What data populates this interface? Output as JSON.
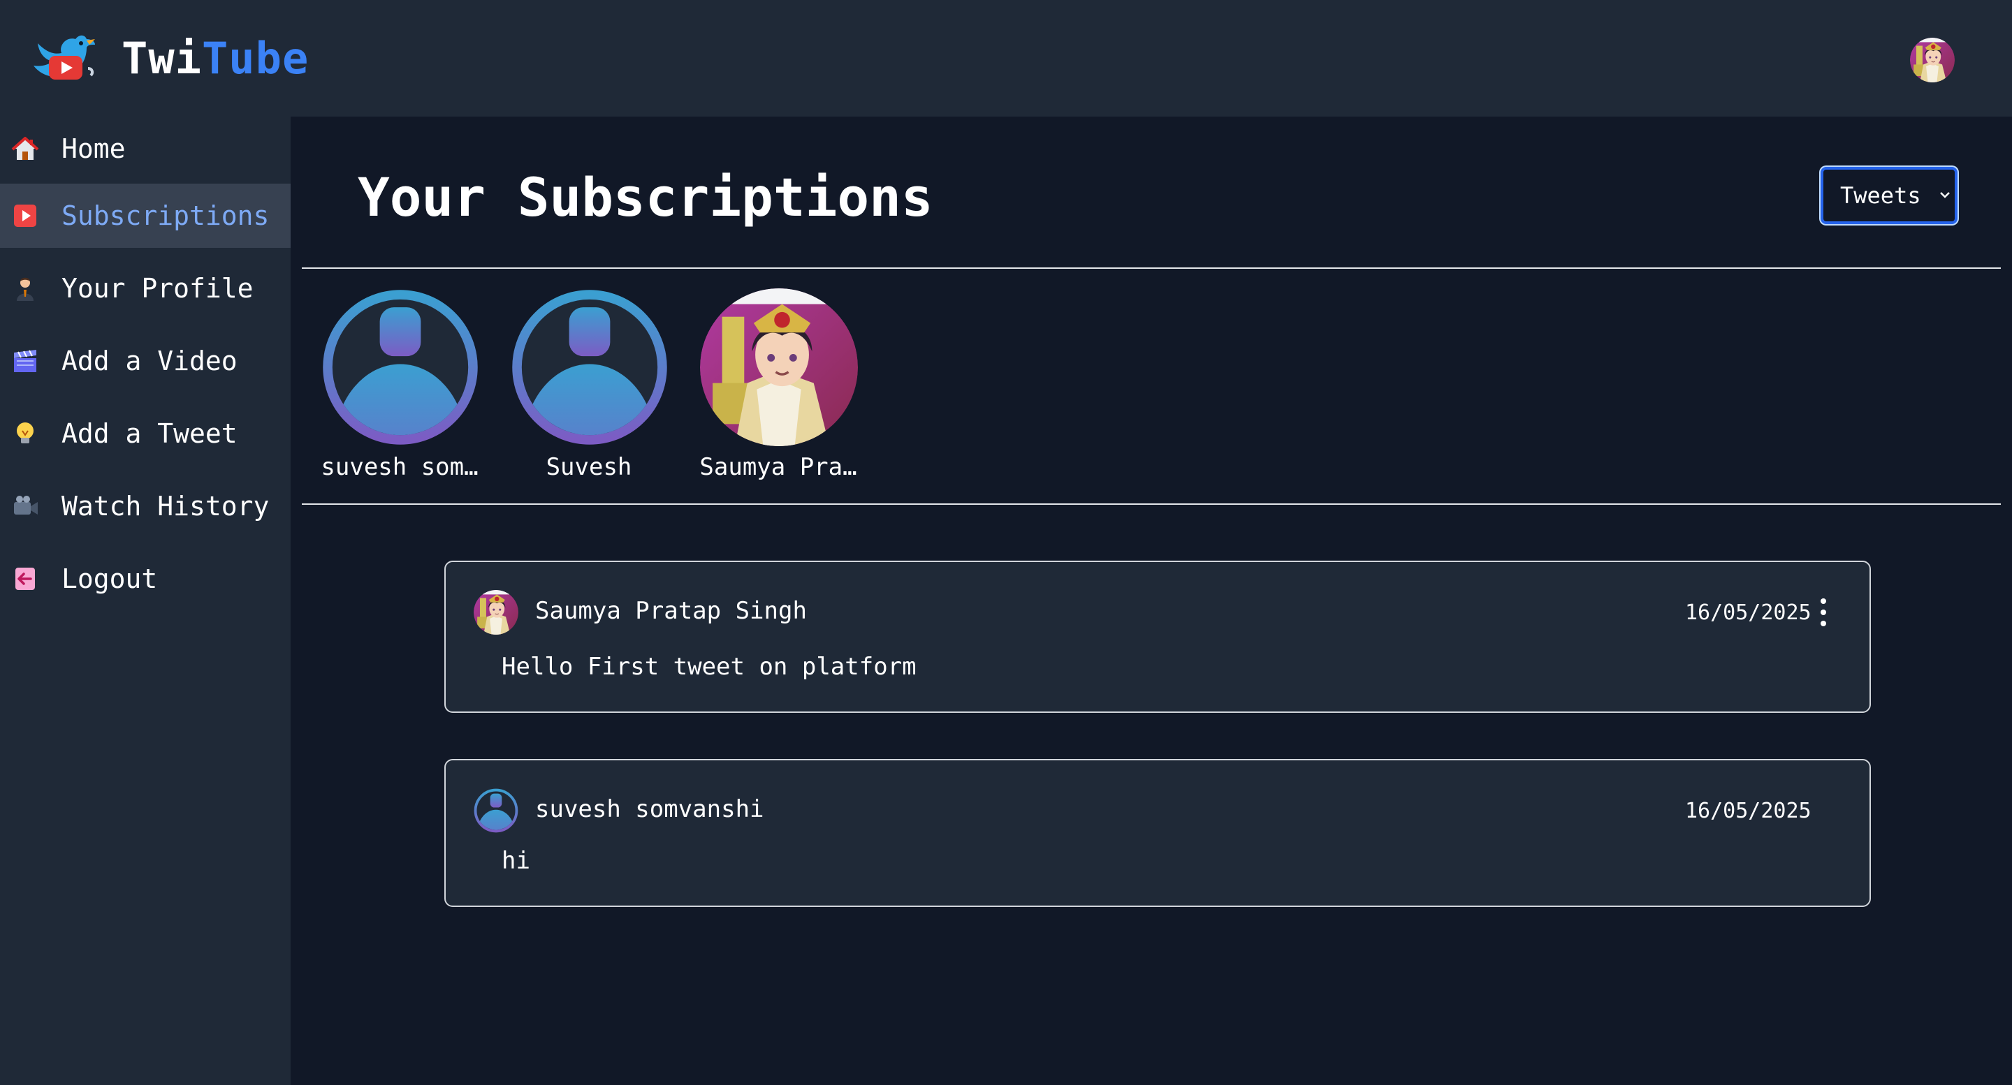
{
  "app": {
    "brand_part1": "Twi",
    "brand_part2": "Tube",
    "logo_icon": "twitube-bird-play-logo",
    "accent_color": "#3b82f6"
  },
  "sidebar": {
    "items": [
      {
        "label": "Home",
        "icon": "house-icon",
        "active": false
      },
      {
        "label": "Subscriptions",
        "icon": "play-button-icon",
        "active": true
      },
      {
        "label": "Your Profile",
        "icon": "person-icon",
        "active": false
      },
      {
        "label": "Add a Video",
        "icon": "clapperboard-icon",
        "active": false
      },
      {
        "label": "Add a Tweet",
        "icon": "lightbulb-icon",
        "active": false
      },
      {
        "label": "Watch History",
        "icon": "video-camera-icon",
        "active": false
      },
      {
        "label": "Logout",
        "icon": "logout-icon",
        "active": false
      }
    ],
    "active_color": "#7eaaf5"
  },
  "main": {
    "title": "Your Subscriptions",
    "filter": {
      "selected": "Tweets"
    }
  },
  "subscriptions": [
    {
      "name": "suvesh som…",
      "avatar": "default-avatar"
    },
    {
      "name": "Suvesh",
      "avatar": "default-avatar"
    },
    {
      "name": "Saumya Pra…",
      "avatar": "anime-avatar"
    }
  ],
  "tweets": [
    {
      "author": "Saumya Pratap Singh",
      "date": "16/05/2025",
      "body": "Hello First tweet on platform",
      "avatar": "anime-avatar",
      "has_menu": true
    },
    {
      "author": "suvesh somvanshi",
      "date": "16/05/2025",
      "body": "hi",
      "avatar": "default-avatar",
      "has_menu": false
    }
  ]
}
